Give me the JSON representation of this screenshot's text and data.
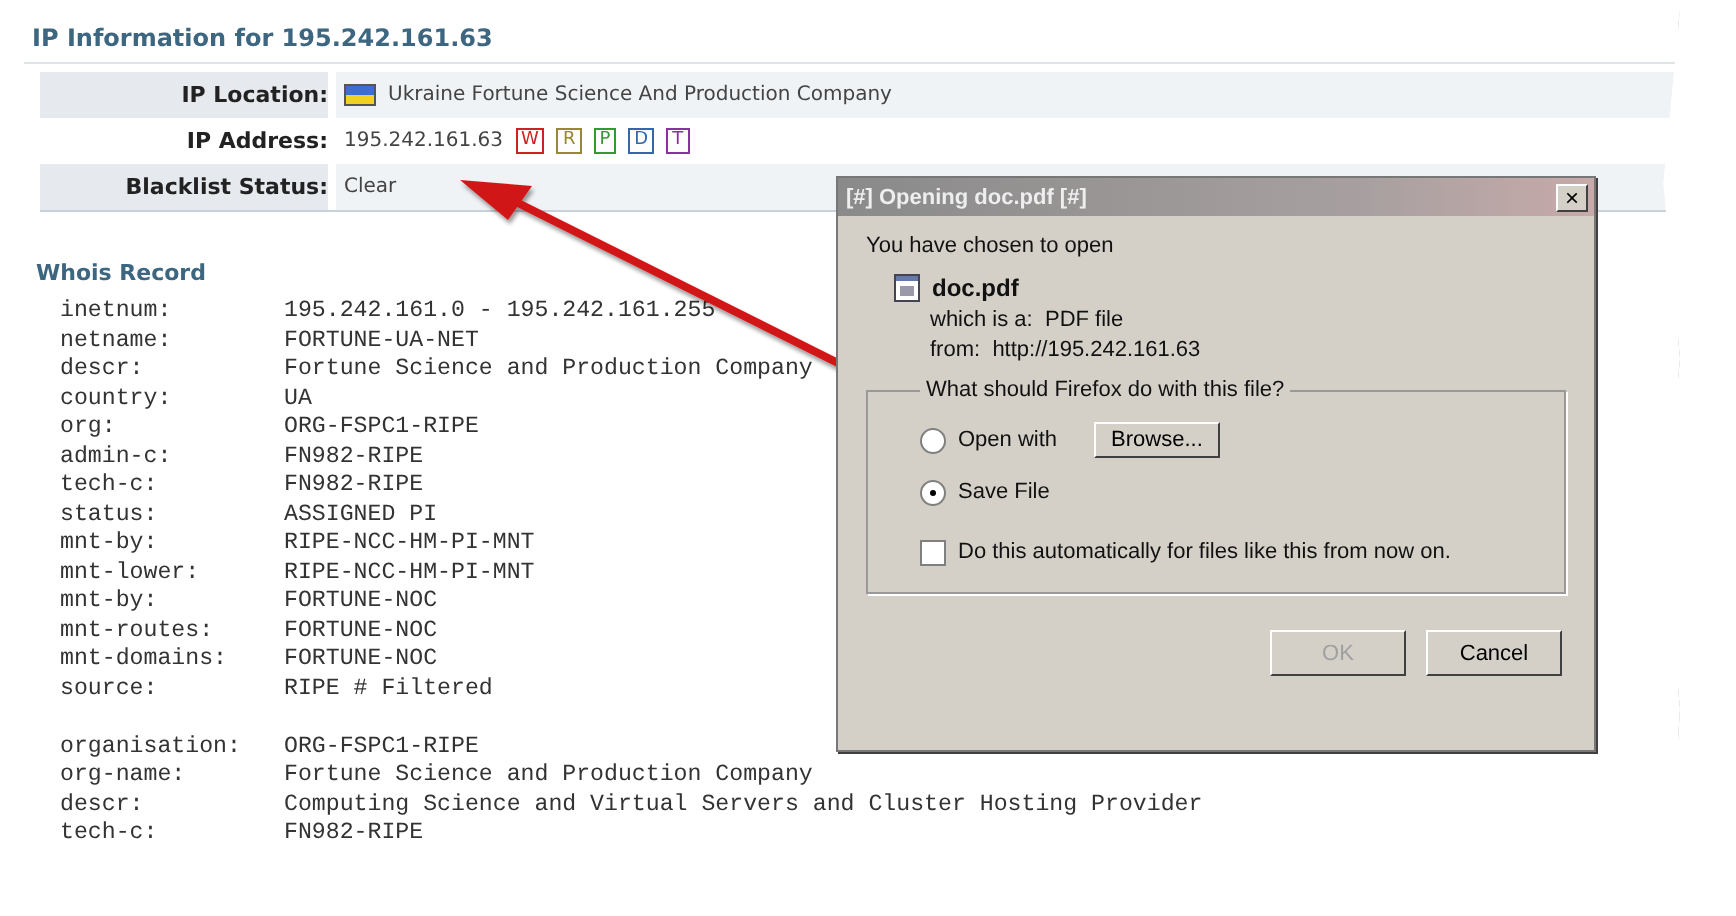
{
  "title": "IP Information for 195.242.161.63",
  "info": [
    {
      "label": "IP Location:",
      "value": "Ukraine Fortune Science And Production Company",
      "kind": "location"
    },
    {
      "label": "IP Address:",
      "value": "195.242.161.63",
      "kind": "address",
      "badges": [
        {
          "text": "W",
          "color": "#cc2222"
        },
        {
          "text": "R",
          "color": "#998833"
        },
        {
          "text": "P",
          "color": "#339933"
        },
        {
          "text": "D",
          "color": "#3366aa"
        },
        {
          "text": "T",
          "color": "#883399"
        }
      ]
    },
    {
      "label": "Blacklist Status:",
      "value": "Clear",
      "kind": "status"
    }
  ],
  "whois": {
    "heading": "Whois Record",
    "blocks": [
      [
        {
          "key": "inetnum:",
          "value": "195.242.161.0 - 195.242.161.255"
        },
        {
          "key": "netname:",
          "value": "FORTUNE-UA-NET"
        },
        {
          "key": "descr:",
          "value": "Fortune Science and Production Company"
        },
        {
          "key": "country:",
          "value": "UA"
        },
        {
          "key": "org:",
          "value": "ORG-FSPC1-RIPE"
        },
        {
          "key": "admin-c:",
          "value": "FN982-RIPE"
        },
        {
          "key": "tech-c:",
          "value": "FN982-RIPE"
        },
        {
          "key": "status:",
          "value": "ASSIGNED PI"
        },
        {
          "key": "mnt-by:",
          "value": "RIPE-NCC-HM-PI-MNT"
        },
        {
          "key": "mnt-lower:",
          "value": "RIPE-NCC-HM-PI-MNT"
        },
        {
          "key": "mnt-by:",
          "value": "FORTUNE-NOC"
        },
        {
          "key": "mnt-routes:",
          "value": "FORTUNE-NOC"
        },
        {
          "key": "mnt-domains:",
          "value": "FORTUNE-NOC"
        },
        {
          "key": "source:",
          "value": "RIPE # Filtered"
        }
      ],
      [
        {
          "key": "organisation:",
          "value": "ORG-FSPC1-RIPE"
        },
        {
          "key": "org-name:",
          "value": "Fortune Science and Production Company"
        },
        {
          "key": "descr:",
          "value": "Computing Science and Virtual Servers and Cluster Hosting Provider"
        },
        {
          "key": "tech-c:",
          "value": "FN982-RIPE"
        }
      ]
    ]
  },
  "dialog": {
    "title": "[#] Opening doc.pdf [#]",
    "close": "×",
    "intro": "You have chosen to open",
    "file": "doc.pdf",
    "type_label": "which is a:",
    "type": "PDF file",
    "from_label": "from:",
    "from": "http://195.242.161.63",
    "group": "What should Firefox do with this file?",
    "options": [
      {
        "label": "Open with",
        "selected": false,
        "button": "Browse..."
      },
      {
        "label": "Save File",
        "selected": true
      }
    ],
    "auto": {
      "label": "Do this automatically for files like this from now on.",
      "checked": false
    },
    "buttons": [
      {
        "label": "OK",
        "disabled": true
      },
      {
        "label": "Cancel",
        "disabled": false
      }
    ]
  }
}
